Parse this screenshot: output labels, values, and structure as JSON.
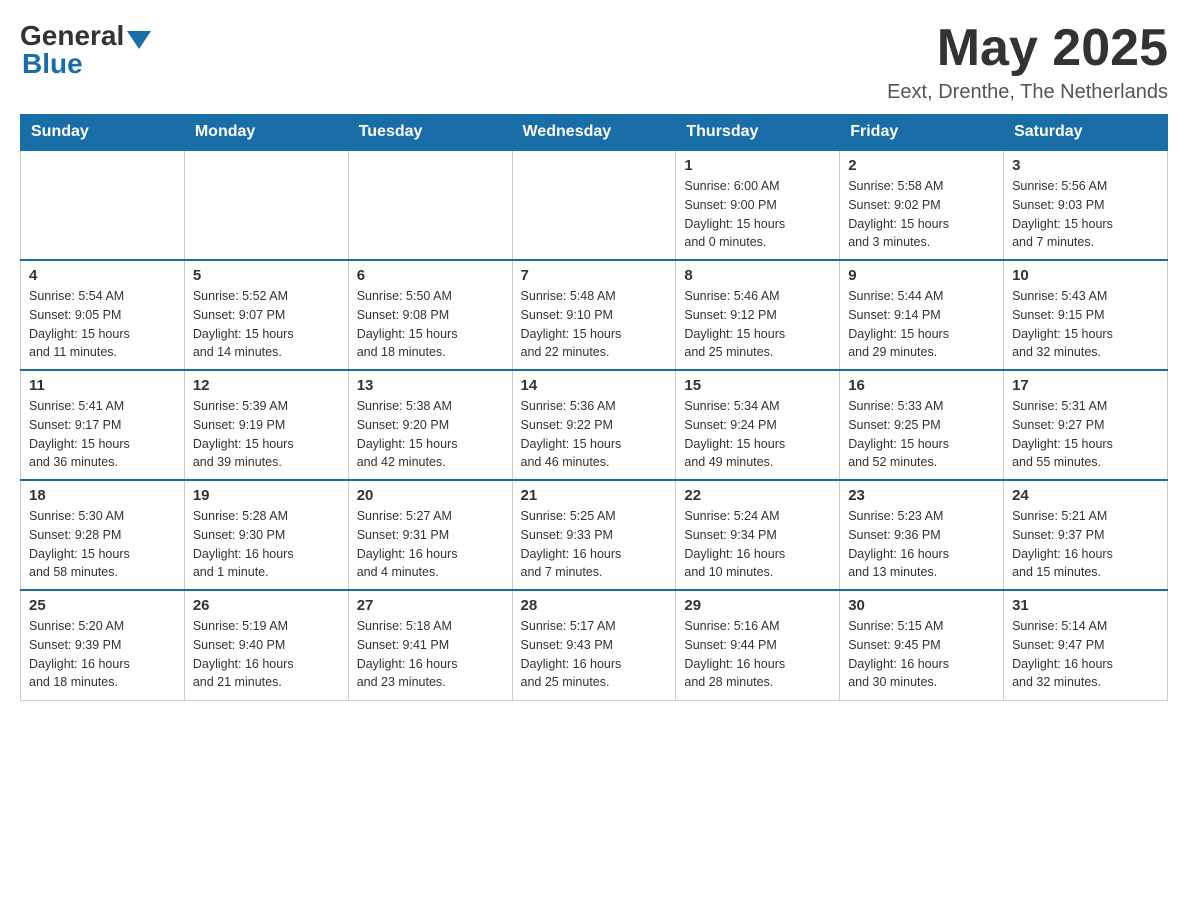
{
  "logo": {
    "general": "General",
    "blue": "Blue",
    "tagline": "Blue"
  },
  "title": "May 2025",
  "location": "Eext, Drenthe, The Netherlands",
  "weekdays": [
    "Sunday",
    "Monday",
    "Tuesday",
    "Wednesday",
    "Thursday",
    "Friday",
    "Saturday"
  ],
  "weeks": [
    [
      {
        "day": "",
        "info": ""
      },
      {
        "day": "",
        "info": ""
      },
      {
        "day": "",
        "info": ""
      },
      {
        "day": "",
        "info": ""
      },
      {
        "day": "1",
        "info": "Sunrise: 6:00 AM\nSunset: 9:00 PM\nDaylight: 15 hours\nand 0 minutes."
      },
      {
        "day": "2",
        "info": "Sunrise: 5:58 AM\nSunset: 9:02 PM\nDaylight: 15 hours\nand 3 minutes."
      },
      {
        "day": "3",
        "info": "Sunrise: 5:56 AM\nSunset: 9:03 PM\nDaylight: 15 hours\nand 7 minutes."
      }
    ],
    [
      {
        "day": "4",
        "info": "Sunrise: 5:54 AM\nSunset: 9:05 PM\nDaylight: 15 hours\nand 11 minutes."
      },
      {
        "day": "5",
        "info": "Sunrise: 5:52 AM\nSunset: 9:07 PM\nDaylight: 15 hours\nand 14 minutes."
      },
      {
        "day": "6",
        "info": "Sunrise: 5:50 AM\nSunset: 9:08 PM\nDaylight: 15 hours\nand 18 minutes."
      },
      {
        "day": "7",
        "info": "Sunrise: 5:48 AM\nSunset: 9:10 PM\nDaylight: 15 hours\nand 22 minutes."
      },
      {
        "day": "8",
        "info": "Sunrise: 5:46 AM\nSunset: 9:12 PM\nDaylight: 15 hours\nand 25 minutes."
      },
      {
        "day": "9",
        "info": "Sunrise: 5:44 AM\nSunset: 9:14 PM\nDaylight: 15 hours\nand 29 minutes."
      },
      {
        "day": "10",
        "info": "Sunrise: 5:43 AM\nSunset: 9:15 PM\nDaylight: 15 hours\nand 32 minutes."
      }
    ],
    [
      {
        "day": "11",
        "info": "Sunrise: 5:41 AM\nSunset: 9:17 PM\nDaylight: 15 hours\nand 36 minutes."
      },
      {
        "day": "12",
        "info": "Sunrise: 5:39 AM\nSunset: 9:19 PM\nDaylight: 15 hours\nand 39 minutes."
      },
      {
        "day": "13",
        "info": "Sunrise: 5:38 AM\nSunset: 9:20 PM\nDaylight: 15 hours\nand 42 minutes."
      },
      {
        "day": "14",
        "info": "Sunrise: 5:36 AM\nSunset: 9:22 PM\nDaylight: 15 hours\nand 46 minutes."
      },
      {
        "day": "15",
        "info": "Sunrise: 5:34 AM\nSunset: 9:24 PM\nDaylight: 15 hours\nand 49 minutes."
      },
      {
        "day": "16",
        "info": "Sunrise: 5:33 AM\nSunset: 9:25 PM\nDaylight: 15 hours\nand 52 minutes."
      },
      {
        "day": "17",
        "info": "Sunrise: 5:31 AM\nSunset: 9:27 PM\nDaylight: 15 hours\nand 55 minutes."
      }
    ],
    [
      {
        "day": "18",
        "info": "Sunrise: 5:30 AM\nSunset: 9:28 PM\nDaylight: 15 hours\nand 58 minutes."
      },
      {
        "day": "19",
        "info": "Sunrise: 5:28 AM\nSunset: 9:30 PM\nDaylight: 16 hours\nand 1 minute."
      },
      {
        "day": "20",
        "info": "Sunrise: 5:27 AM\nSunset: 9:31 PM\nDaylight: 16 hours\nand 4 minutes."
      },
      {
        "day": "21",
        "info": "Sunrise: 5:25 AM\nSunset: 9:33 PM\nDaylight: 16 hours\nand 7 minutes."
      },
      {
        "day": "22",
        "info": "Sunrise: 5:24 AM\nSunset: 9:34 PM\nDaylight: 16 hours\nand 10 minutes."
      },
      {
        "day": "23",
        "info": "Sunrise: 5:23 AM\nSunset: 9:36 PM\nDaylight: 16 hours\nand 13 minutes."
      },
      {
        "day": "24",
        "info": "Sunrise: 5:21 AM\nSunset: 9:37 PM\nDaylight: 16 hours\nand 15 minutes."
      }
    ],
    [
      {
        "day": "25",
        "info": "Sunrise: 5:20 AM\nSunset: 9:39 PM\nDaylight: 16 hours\nand 18 minutes."
      },
      {
        "day": "26",
        "info": "Sunrise: 5:19 AM\nSunset: 9:40 PM\nDaylight: 16 hours\nand 21 minutes."
      },
      {
        "day": "27",
        "info": "Sunrise: 5:18 AM\nSunset: 9:41 PM\nDaylight: 16 hours\nand 23 minutes."
      },
      {
        "day": "28",
        "info": "Sunrise: 5:17 AM\nSunset: 9:43 PM\nDaylight: 16 hours\nand 25 minutes."
      },
      {
        "day": "29",
        "info": "Sunrise: 5:16 AM\nSunset: 9:44 PM\nDaylight: 16 hours\nand 28 minutes."
      },
      {
        "day": "30",
        "info": "Sunrise: 5:15 AM\nSunset: 9:45 PM\nDaylight: 16 hours\nand 30 minutes."
      },
      {
        "day": "31",
        "info": "Sunrise: 5:14 AM\nSunset: 9:47 PM\nDaylight: 16 hours\nand 32 minutes."
      }
    ]
  ]
}
